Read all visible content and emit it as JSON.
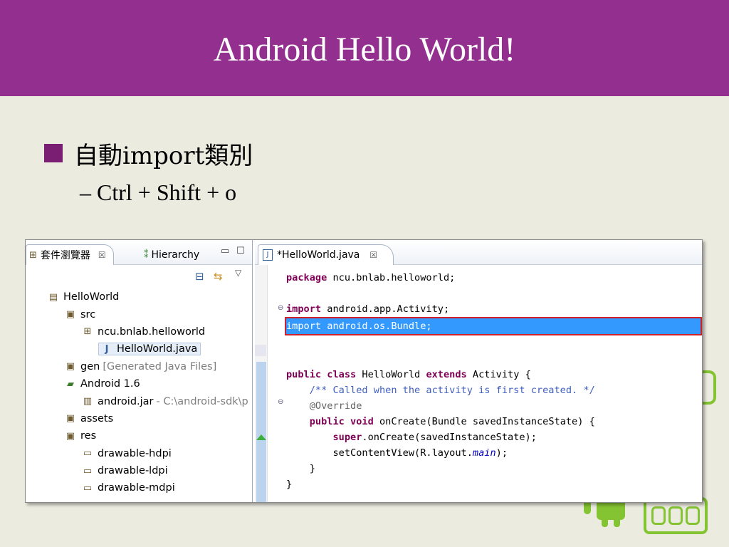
{
  "slide": {
    "title": "Android Hello World!",
    "bullet": "自動import類別",
    "sub_dash": "–",
    "sub_bullet": "Ctrl + Shift + o"
  },
  "colors": {
    "title_bar": "#93308f",
    "background": "#ecebe0",
    "android_green": "#84c332",
    "highlight": "#3399ff"
  },
  "package_explorer": {
    "tab_label": "套件瀏覽器",
    "tab_close": "☒",
    "hierarchy_label": "Hierarchy",
    "minimize": "▭",
    "maximize": "☐",
    "tree": [
      {
        "level": 0,
        "icon": "project-icon",
        "label": "HelloWorld",
        "extra": ""
      },
      {
        "level": 1,
        "icon": "folder-icon",
        "label": "src",
        "extra": ""
      },
      {
        "level": 2,
        "icon": "package-icon",
        "label": "ncu.bnlab.helloworld",
        "extra": ""
      },
      {
        "level": 3,
        "icon": "java-file-icon",
        "label": "HelloWorld.java",
        "extra": "",
        "selected": true
      },
      {
        "level": 1,
        "icon": "gen-folder-icon",
        "label": "gen",
        "extra": "[Generated Java Files]"
      },
      {
        "level": 1,
        "icon": "library-icon",
        "label": "Android 1.6",
        "extra": ""
      },
      {
        "level": 2,
        "icon": "jar-icon",
        "label": "android.jar",
        "extra": "- C:\\android-sdk\\p"
      },
      {
        "level": 1,
        "icon": "folder-icon",
        "label": "assets",
        "extra": ""
      },
      {
        "level": 1,
        "icon": "folder-icon",
        "label": "res",
        "extra": ""
      },
      {
        "level": 2,
        "icon": "open-folder-icon",
        "label": "drawable-hdpi",
        "extra": ""
      },
      {
        "level": 2,
        "icon": "open-folder-icon",
        "label": "drawable-ldpi",
        "extra": ""
      },
      {
        "level": 2,
        "icon": "open-folder-icon",
        "label": "drawable-mdpi",
        "extra": ""
      }
    ]
  },
  "editor": {
    "tab_label": "*HelloWorld.java",
    "tab_close": "☒",
    "lines": [
      [
        {
          "t": "package",
          "c": "kw"
        },
        {
          "t": " ncu.bnlab.helloworld;",
          "c": ""
        }
      ],
      [],
      [
        {
          "t": "import",
          "c": "kw"
        },
        {
          "t": " android.app.Activity;",
          "c": ""
        }
      ],
      [
        {
          "t": "import android.os.Bundle;",
          "c": ""
        }
      ],
      [],
      [],
      [
        {
          "t": "public",
          "c": "kw"
        },
        {
          "t": " ",
          "c": ""
        },
        {
          "t": "class",
          "c": "kw"
        },
        {
          "t": " HelloWorld ",
          "c": ""
        },
        {
          "t": "extends",
          "c": "kw"
        },
        {
          "t": " Activity {",
          "c": ""
        }
      ],
      [
        {
          "t": "    /** Called when the activity is first created. */",
          "c": "cm"
        }
      ],
      [
        {
          "t": "    @Override",
          "c": "an"
        }
      ],
      [
        {
          "t": "    ",
          "c": ""
        },
        {
          "t": "public",
          "c": "kw"
        },
        {
          "t": " ",
          "c": ""
        },
        {
          "t": "void",
          "c": "kw"
        },
        {
          "t": " onCreate(Bundle savedInstanceState) {",
          "c": ""
        }
      ],
      [
        {
          "t": "        ",
          "c": ""
        },
        {
          "t": "super",
          "c": "kw"
        },
        {
          "t": ".onCreate(savedInstanceState);",
          "c": ""
        }
      ],
      [
        {
          "t": "        setContentView(R.layout.",
          "c": ""
        },
        {
          "t": "main",
          "c": "it"
        },
        {
          "t": ");",
          "c": ""
        }
      ],
      [
        {
          "t": "    }",
          "c": ""
        }
      ],
      [
        {
          "t": "}",
          "c": ""
        }
      ]
    ],
    "highlighted_line": 3,
    "fold_markers": [
      2,
      8
    ]
  }
}
